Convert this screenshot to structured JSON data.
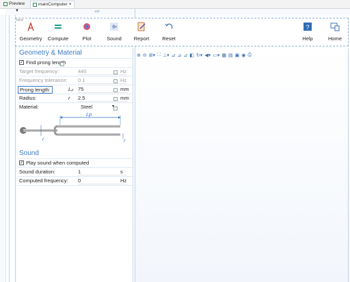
{
  "tabs": [
    {
      "label": "Preview",
      "icon": "preview-icon"
    },
    {
      "label": "mainComputer",
      "icon": "form-icon",
      "close": "×"
    }
  ],
  "ruler": {
    "mark": "100"
  },
  "form_tag": "form",
  "toolbar": {
    "geometry": "Geometry",
    "compute": "Compute",
    "plot": "Plot",
    "sound": "Sound",
    "report": "Report",
    "reset": "Reset",
    "help": "Help",
    "home": "Home"
  },
  "geometry_section": {
    "title": "Geometry & Material",
    "find_prong_length": {
      "label": "Find prong length",
      "checked": true
    },
    "target_frequency": {
      "label": "Target frequency:",
      "value": "440",
      "unit": "Hz"
    },
    "frequency_tolerance": {
      "label": "Frequency tolerance:",
      "value": "0.1",
      "unit": "Hz"
    },
    "prong_length": {
      "label": "Prong length:",
      "symbol": "Lₚ",
      "value": "75",
      "unit": "mm"
    },
    "radius": {
      "label": "Radius:",
      "symbol": "r",
      "value": "2.5",
      "unit": "mm"
    },
    "material": {
      "label": "Material:",
      "value": "Steel"
    },
    "diagram": {
      "lp": "Lp",
      "r": "r"
    }
  },
  "sound_section": {
    "title": "Sound",
    "play_sound": {
      "label": "Play sound when computed",
      "checked": true
    },
    "sound_duration": {
      "label": "Sound duration:",
      "value": "1",
      "unit": "s"
    },
    "computed_frequency": {
      "label": "Computed frequency:",
      "value": "0",
      "unit": "Hz"
    }
  },
  "colors": {
    "accent": "#3b7bc4",
    "grid": "#bfd3ea"
  }
}
